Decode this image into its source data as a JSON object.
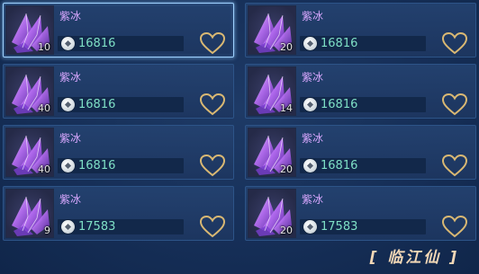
{
  "listings": [
    {
      "name": "紫冰",
      "quantity": "10",
      "price": "16816",
      "selected": true
    },
    {
      "name": "紫冰",
      "quantity": "20",
      "price": "16816",
      "selected": false
    },
    {
      "name": "紫冰",
      "quantity": "40",
      "price": "16816",
      "selected": false
    },
    {
      "name": "紫冰",
      "quantity": "14",
      "price": "16816",
      "selected": false
    },
    {
      "name": "紫冰",
      "quantity": "40",
      "price": "16816",
      "selected": false
    },
    {
      "name": "紫冰",
      "quantity": "20",
      "price": "16816",
      "selected": false
    },
    {
      "name": "紫冰",
      "quantity": "9",
      "price": "17583",
      "selected": false
    },
    {
      "name": "紫冰",
      "quantity": "20",
      "price": "17583",
      "selected": false
    }
  ],
  "watermark": "[ 临江仙 ]",
  "icons": {
    "item": "purple-ice-crystal-icon",
    "currency": "silver-coin-icon",
    "favorite": "heart-outline-icon"
  },
  "colors": {
    "name": "#d9a8ff",
    "price": "#7fe0c6",
    "heart": "#d9b873",
    "selected_border": "#9fd2ff"
  }
}
